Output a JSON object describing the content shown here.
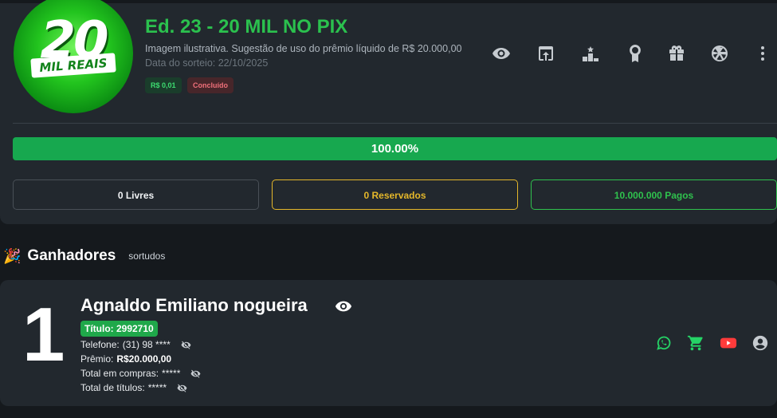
{
  "raffle": {
    "logo_number": "20",
    "logo_text": "MIL REAIS",
    "title": "Ed. 23 - 20 MIL NO PIX",
    "subtitle": "Imagem ilustrativa. Sugestão de uso do prêmio líquido de R$ 20.000,00",
    "date": "Data do sorteio: 22/10/2025",
    "price_badge": "R$ 0,01",
    "status_badge": "Concluído",
    "progress_percent": 100,
    "progress_label": "100.00%",
    "stats": {
      "free": "0 Livres",
      "reserved": "0 Reservados",
      "paid": "10.000.000 Pagos"
    },
    "actions": [
      "eye-icon",
      "share-icon",
      "podium-icon",
      "award-icon",
      "gift-icon",
      "spin-wheel-icon",
      "more-vert-icon"
    ]
  },
  "winners_section": {
    "icon": "🎉",
    "title": "Ganhadores",
    "subtitle": "sortudos"
  },
  "winner": {
    "rank": "1",
    "name": "Agnaldo Emiliano nogueira",
    "ticket": "Título: 2992710",
    "phone_label": "Telefone:",
    "phone_value": "(31) 98 ****",
    "prize_label": "Prêmio:",
    "prize_value": "R$20.000,00",
    "purchases_label": "Total em compras:",
    "purchases_value": "*****",
    "titles_label": "Total de títulos:",
    "titles_value": "*****",
    "actions": [
      "whatsapp-icon",
      "cart-icon",
      "youtube-icon",
      "user-icon"
    ]
  },
  "colors": {
    "accent_green": "#2bc14e",
    "progress_green": "#17a84f",
    "reserved_yellow": "#e4b72a",
    "whatsapp_green": "#25d366",
    "youtube_red": "#ff3b3b"
  }
}
